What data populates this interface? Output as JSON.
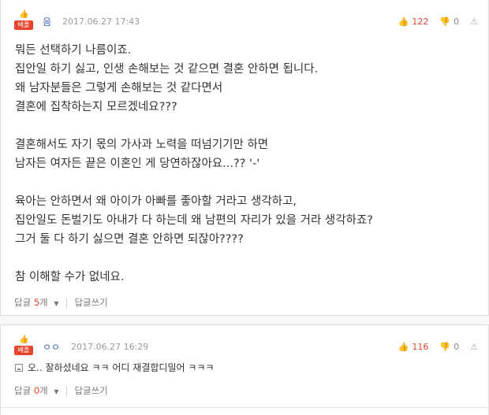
{
  "comments": [
    {
      "badge": "베플",
      "author": "음",
      "date": "2017.06.27 17:43",
      "upvotes": "122",
      "downvotes": "0",
      "body": "뭐든 선택하기 나름이죠.\n집안일 하기 싫고, 인생 손해보는 것 같으면 결혼 안하면 됩니다.\n왜 남자분들은 그렇게 손해보는 것 같다면서\n결혼에 집착하는지 모르겠네요???\n\n결혼해서도 자기 몫의 가사과 노력을 떠넘기기만 하면\n남자든 여자든 끝은 이혼인 게 당연하잖아요...?? '-'\n\n육아는 안하면서 왜 아이가 아빠를 좋아할 거라고 생각하고,\n집안일도 돈벌기도 아내가 다 하는데 왜 남편의 자리가 있을 거라 생각하죠?\n그거 둘 다 하기 싫으면 결혼 안하면 되잖아????\n\n참 이해할 수가 없네요.",
      "reply_label": "답글",
      "reply_count": "5",
      "reply_unit": "개",
      "write_reply": "답글쓰기"
    },
    {
      "badge": "베플",
      "author": "ㅇㅇ",
      "date": "2017.06.27 16:29",
      "upvotes": "116",
      "downvotes": "0",
      "body": "오.. 잘하셨네요 ㅋㅋ 어디 재결합디밀어 ㅋㅋㅋ",
      "reply_label": "답글",
      "reply_count": "0",
      "reply_unit": "개",
      "write_reply": "답글쓰기"
    }
  ],
  "icons": {
    "upvote": "thumbs-up-icon",
    "downvote": "thumbs-down-icon",
    "report": "report-icon",
    "image": "image-icon"
  },
  "colors": {
    "accent": "#e8442e",
    "author": "#3a66b0",
    "muted": "#9a9a9a"
  }
}
